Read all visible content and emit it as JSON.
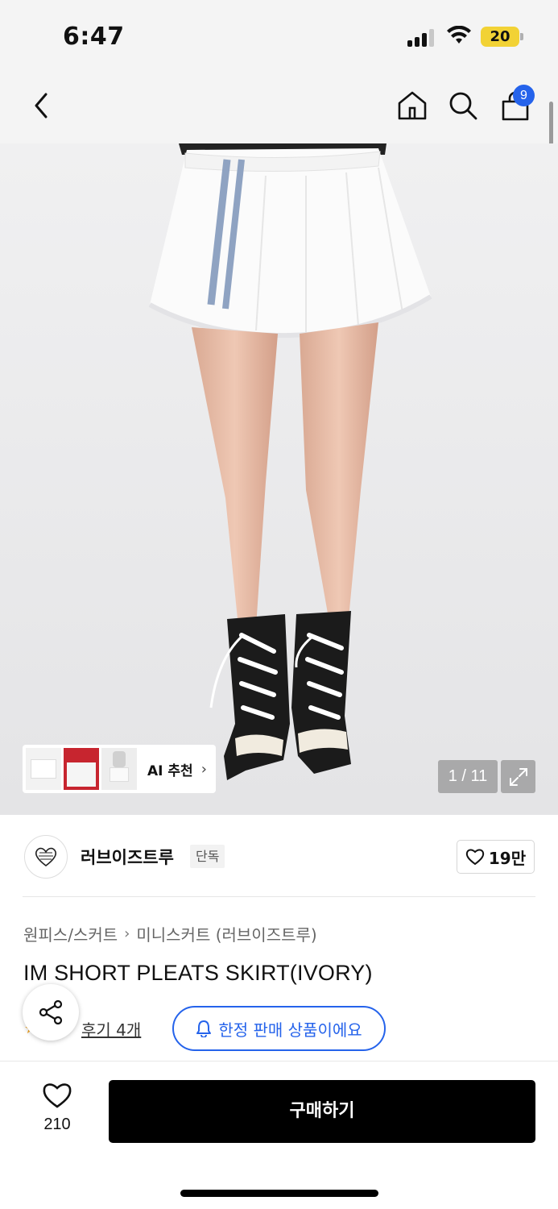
{
  "status_bar": {
    "time": "6:47",
    "battery": "20"
  },
  "header": {
    "cart_count": "9"
  },
  "gallery": {
    "ai_label": "AI 추천",
    "page_indicator": "1 / 11"
  },
  "brand": {
    "name": "러브이즈트루",
    "tag": "단독",
    "likes": "19만"
  },
  "breadcrumb": {
    "level1": "원피스/스커트",
    "level2": "미니스커트 (러브이즈트루)"
  },
  "product": {
    "title": "IM SHORT PLEATS SKIRT(IVORY)",
    "reviews": "후기 4개",
    "limited_label": "한정 판매 상품이에요"
  },
  "bottom": {
    "wish_count": "210",
    "buy_label": "구매하기"
  },
  "colors": {
    "accent": "#2563eb",
    "buy": "#000000",
    "image_bg": "#ececed"
  },
  "icons": [
    "back-icon",
    "home-icon",
    "search-icon",
    "cart-icon",
    "expand-icon",
    "heart-icon",
    "share-icon",
    "bell-icon",
    "star-icon"
  ]
}
